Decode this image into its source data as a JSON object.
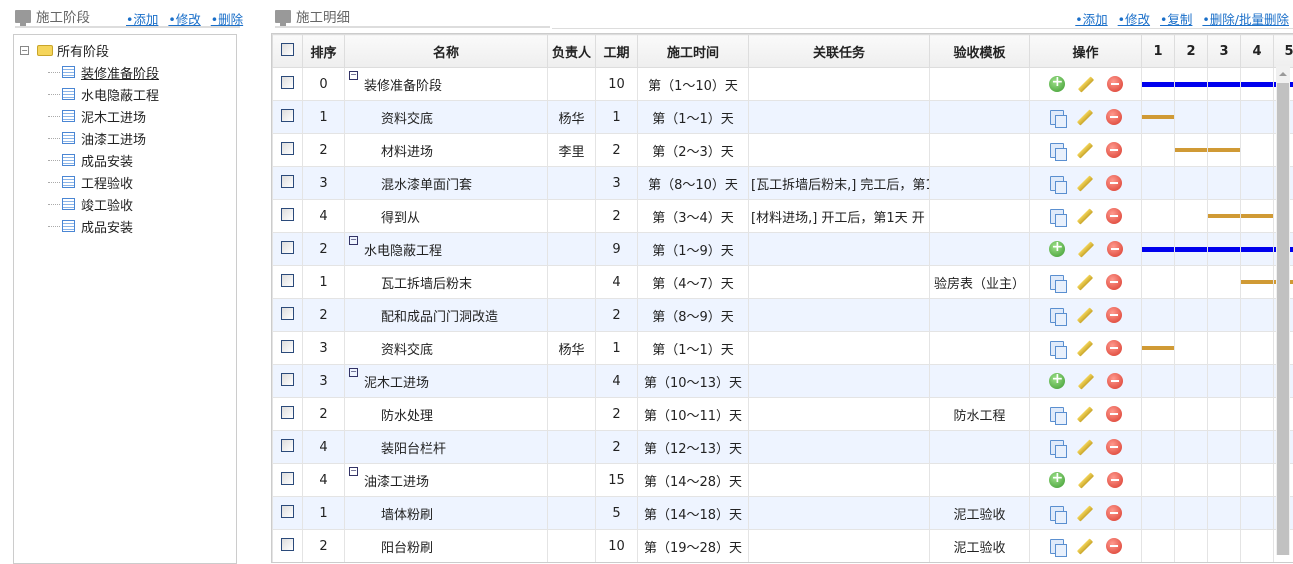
{
  "left": {
    "title": "施工阶段",
    "links": [
      "•添加",
      "•修改",
      "•删除"
    ],
    "tree": {
      "root": "所有阶段",
      "selected": 0,
      "items": [
        "装修准备阶段",
        "水电隐蔽工程",
        "泥木工进场",
        "油漆工进场",
        "成品安装",
        "工程验收",
        "竣工验收",
        "成品安装"
      ]
    }
  },
  "right": {
    "title": "施工明细",
    "links": [
      "•添加",
      "•修改",
      "•复制",
      "•删除/批量删除"
    ]
  },
  "grid": {
    "headers": [
      "排序",
      "名称",
      "负责人",
      "工期",
      "施工时间",
      "关联任务",
      "验收模板",
      "操作"
    ],
    "days": [
      "1",
      "2",
      "3",
      "4",
      "5"
    ],
    "colors": {
      "parent_bar": "#0000ee",
      "child_bar": "#d09a35",
      "alt_row": "#eef4ff"
    },
    "rows": [
      {
        "order": "0",
        "name": "装修准备阶段",
        "owner": "",
        "duration": "10",
        "time": "第（1～10）天",
        "related": "",
        "template": "",
        "parent": true,
        "start": 1,
        "end": 10
      },
      {
        "order": "1",
        "name": "资料交底",
        "owner": "杨华",
        "duration": "1",
        "time": "第（1～1）天",
        "related": "",
        "template": "",
        "parent": false,
        "start": 1,
        "end": 1
      },
      {
        "order": "2",
        "name": "材料进场",
        "owner": "李里",
        "duration": "2",
        "time": "第（2～3）天",
        "related": "",
        "template": "",
        "parent": false,
        "start": 2,
        "end": 3
      },
      {
        "order": "3",
        "name": "混水漆单面门套",
        "owner": "",
        "duration": "3",
        "time": "第（8～10）天",
        "related": "[瓦工拆墙后粉末,] 完工后，第1",
        "template": "",
        "parent": false,
        "start": 8,
        "end": 10
      },
      {
        "order": "4",
        "name": "得到从",
        "owner": "",
        "duration": "2",
        "time": "第（3～4）天",
        "related": " [材料进场,] 开工后，第1天 开",
        "template": "",
        "parent": false,
        "start": 3,
        "end": 4
      },
      {
        "order": "2",
        "name": "水电隐蔽工程",
        "owner": "",
        "duration": "9",
        "time": "第（1～9）天",
        "related": "",
        "template": "",
        "parent": true,
        "start": 1,
        "end": 9
      },
      {
        "order": "1",
        "name": "瓦工拆墙后粉末",
        "owner": "",
        "duration": "4",
        "time": "第（4～7）天",
        "related": "",
        "template": "验房表（业主）",
        "parent": false,
        "start": 4,
        "end": 7
      },
      {
        "order": "2",
        "name": "配和成品门门洞改造",
        "owner": "",
        "duration": "2",
        "time": "第（8～9）天",
        "related": "",
        "template": "",
        "parent": false,
        "start": 8,
        "end": 9
      },
      {
        "order": "3",
        "name": "资料交底",
        "owner": "杨华",
        "duration": "1",
        "time": "第（1～1）天",
        "related": "",
        "template": "",
        "parent": false,
        "start": 1,
        "end": 1
      },
      {
        "order": "3",
        "name": "泥木工进场",
        "owner": "",
        "duration": "4",
        "time": "第（10～13）天",
        "related": "",
        "template": "",
        "parent": true,
        "start": 10,
        "end": 13
      },
      {
        "order": "2",
        "name": "防水处理",
        "owner": "",
        "duration": "2",
        "time": "第（10～11）天",
        "related": "",
        "template": "防水工程",
        "parent": false,
        "start": 10,
        "end": 11
      },
      {
        "order": "4",
        "name": "装阳台栏杆",
        "owner": "",
        "duration": "2",
        "time": "第（12～13）天",
        "related": "",
        "template": "",
        "parent": false,
        "start": 12,
        "end": 13
      },
      {
        "order": "4",
        "name": "油漆工进场",
        "owner": "",
        "duration": "15",
        "time": "第（14～28）天",
        "related": "",
        "template": "",
        "parent": true,
        "start": 14,
        "end": 28
      },
      {
        "order": "1",
        "name": "墙体粉刷",
        "owner": "",
        "duration": "5",
        "time": "第（14～18）天",
        "related": "",
        "template": "泥工验收",
        "parent": false,
        "start": 14,
        "end": 18
      },
      {
        "order": "2",
        "name": "阳台粉刷",
        "owner": "",
        "duration": "10",
        "time": "第（19～28）天",
        "related": "",
        "template": "泥工验收",
        "parent": false,
        "start": 19,
        "end": 28
      }
    ]
  }
}
